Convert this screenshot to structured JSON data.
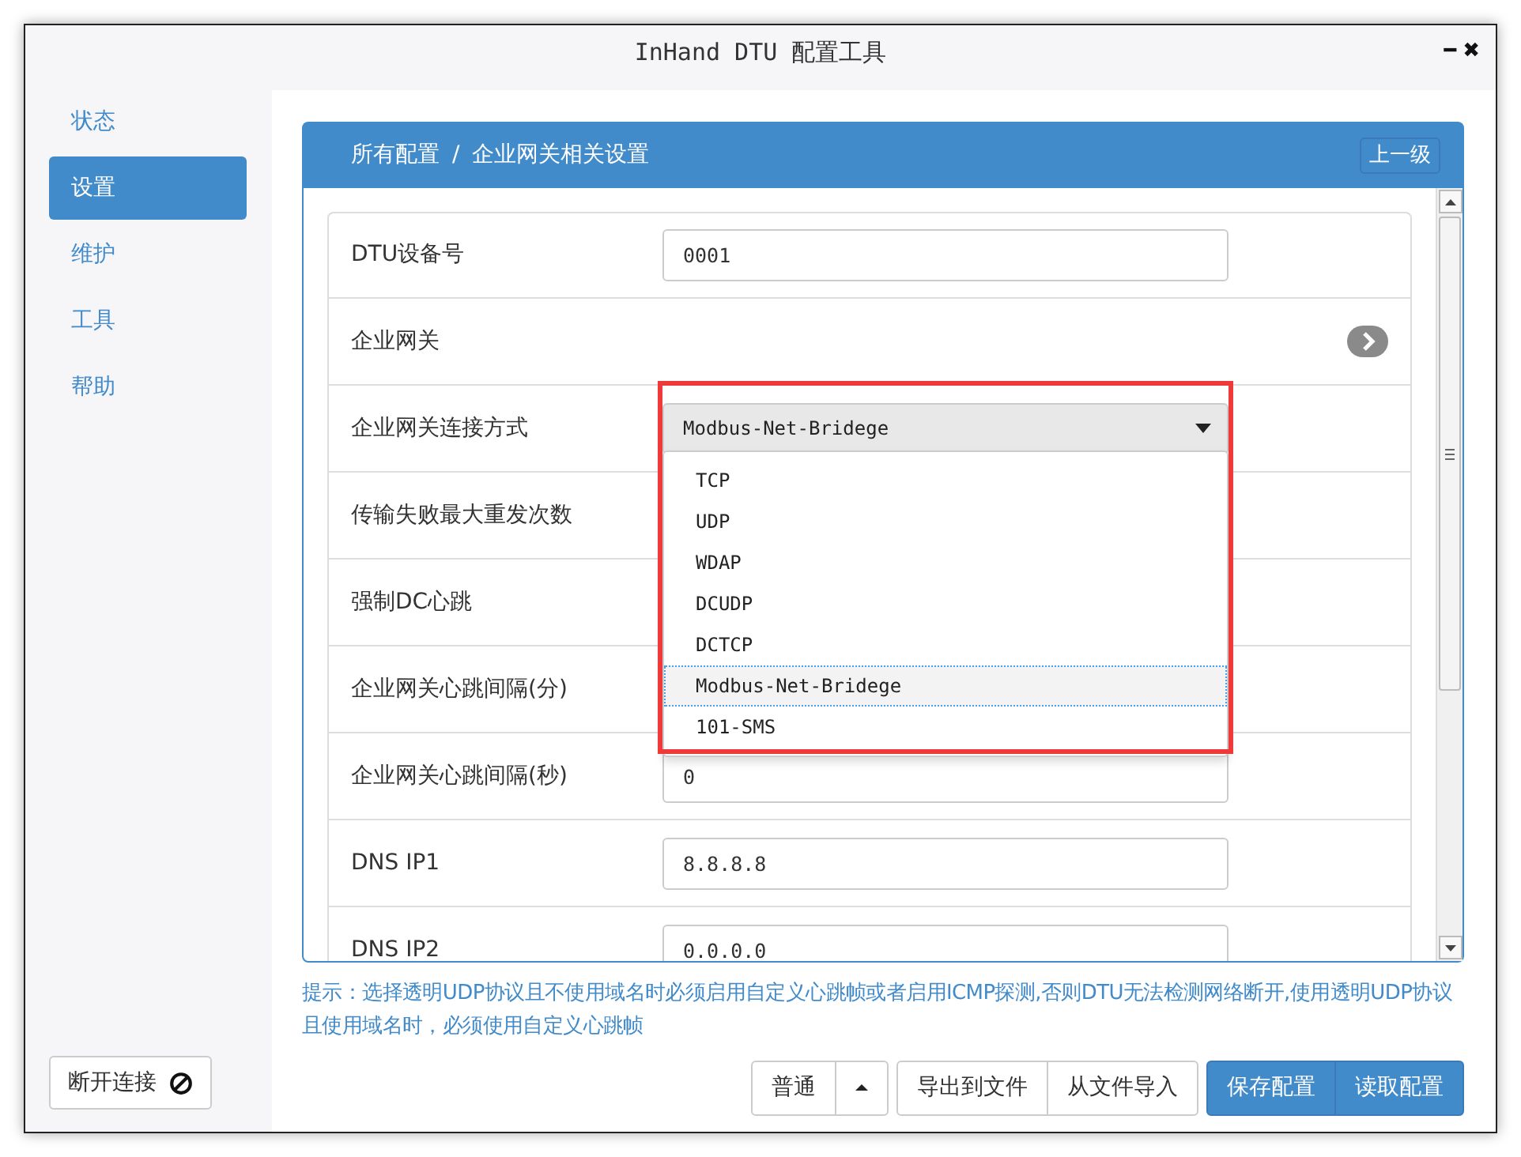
{
  "window": {
    "title": "InHand DTU 配置工具",
    "controls": [
      "━",
      "✖"
    ]
  },
  "sidebar": {
    "items": [
      {
        "label": "状态",
        "selected": false
      },
      {
        "label": "设置",
        "selected": true
      },
      {
        "label": "维护",
        "selected": false
      },
      {
        "label": "工具",
        "selected": false
      },
      {
        "label": "帮助",
        "selected": false
      }
    ],
    "disconnect_button": "断开连接"
  },
  "panel": {
    "breadcrumb": [
      "所有配置",
      "企业网关相关设置"
    ],
    "separator": "/",
    "up_button": "上一级"
  },
  "form": {
    "rows": [
      {
        "kind": "input",
        "label": "DTU设备号",
        "value": "0001"
      },
      {
        "kind": "section",
        "label": "企业网关"
      },
      {
        "kind": "select",
        "label": "企业网关连接方式",
        "value": "Modbus-Net-Bridege",
        "highlighted": true,
        "expanded": true,
        "options": [
          {
            "label": "TCP",
            "selected": false
          },
          {
            "label": "UDP",
            "selected": false
          },
          {
            "label": "WDAP",
            "selected": false
          },
          {
            "label": "DCUDP",
            "selected": false
          },
          {
            "label": "DCTCP",
            "selected": false
          },
          {
            "label": "Modbus-Net-Bridege",
            "selected": true
          },
          {
            "label": "101-SMS",
            "selected": false
          }
        ]
      },
      {
        "kind": "covered",
        "label": "传输失败最大重发次数"
      },
      {
        "kind": "covered",
        "label": "强制DC心跳"
      },
      {
        "kind": "covered",
        "label": "企业网关心跳间隔(分)"
      },
      {
        "kind": "input",
        "label": "企业网关心跳间隔(秒)",
        "value": "0"
      },
      {
        "kind": "input",
        "label": "DNS IP1",
        "value": "8.8.8.8"
      },
      {
        "kind": "input",
        "label": "DNS IP2",
        "value": "0.0.0.0"
      }
    ]
  },
  "hint": "提示：选择透明UDP协议且不使用域名时必须启用自定义心跳帧或者启用ICMP探测,否则DTU无法检测网络断开,使用透明UDP协议且使用域名时，必须使用自定义心跳帧",
  "footer": {
    "mode_button": "普通",
    "buttons": [
      {
        "label": "导出到文件",
        "kind": "default"
      },
      {
        "label": "从文件导入",
        "kind": "default"
      },
      {
        "label": "保存配置",
        "kind": "primary"
      },
      {
        "label": "读取配置",
        "kind": "primary"
      }
    ]
  }
}
